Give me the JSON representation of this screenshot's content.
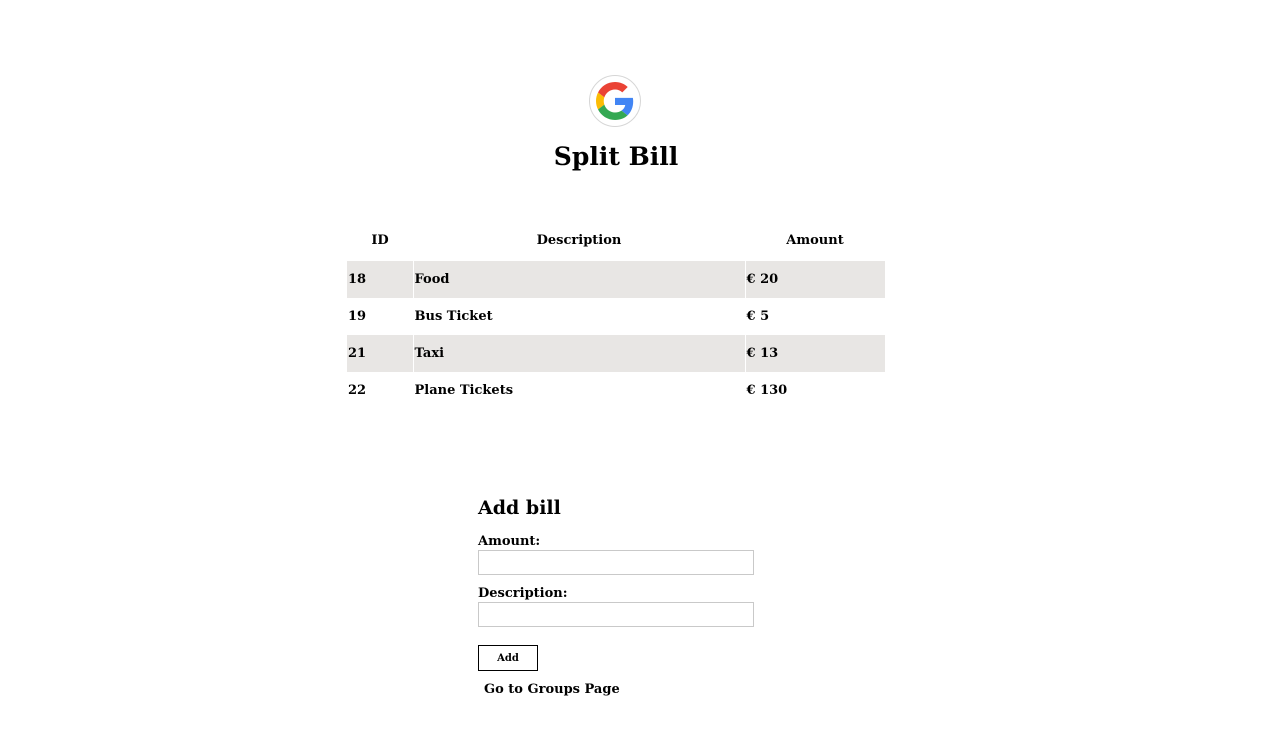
{
  "header": {
    "title": "Split Bill",
    "avatar_icon": "google-g-logo-icon"
  },
  "bills_table": {
    "headers": [
      "ID",
      "Description",
      "Amount"
    ],
    "rows": [
      {
        "id": "18",
        "description": "Food",
        "amount": "€ 20"
      },
      {
        "id": "19",
        "description": "Bus Ticket",
        "amount": "€ 5"
      },
      {
        "id": "21",
        "description": "Taxi",
        "amount": "€ 13"
      },
      {
        "id": "22",
        "description": "Plane Tickets",
        "amount": "€ 130"
      }
    ]
  },
  "add_bill": {
    "title": "Add bill",
    "amount_label": "Amount:",
    "amount_value": "",
    "description_label": "Description:",
    "description_value": "",
    "add_button": "Add"
  },
  "links": {
    "groups_page": "Go to Groups Page"
  },
  "colors": {
    "row_shade": "#e8e6e4",
    "input_border": "#c9c9c9",
    "google_blue": "#4285F4",
    "google_red": "#EA4335",
    "google_yellow": "#FBBC05",
    "google_green": "#34A853"
  }
}
